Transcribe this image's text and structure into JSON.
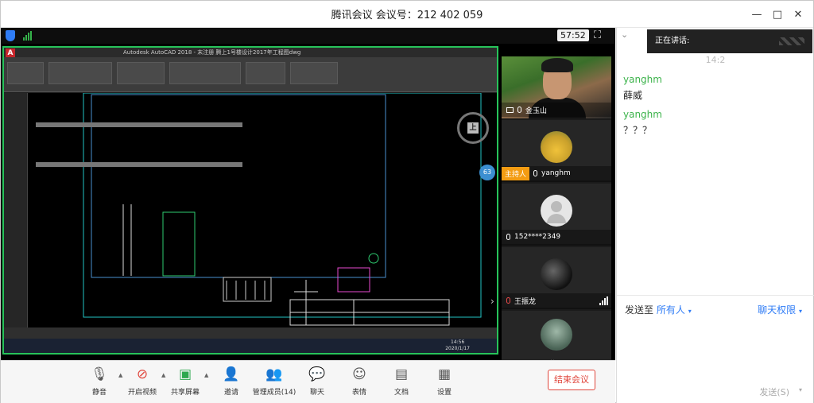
{
  "window": {
    "title": "腾讯会议 会议号：212 402 059",
    "minimize": "—",
    "maximize": "□",
    "close": "✕"
  },
  "video_bar": {
    "timer": "57:52"
  },
  "shared_screen": {
    "cad_title": "Autodesk AutoCAD 2018 - 末注册 腾上1号楼设计2017年工程图dwg",
    "cad_logo": "A",
    "zoom_pct": "63",
    "compass_label": "上",
    "clock_time": "14:56",
    "clock_date": "2020/1/17"
  },
  "participants": [
    {
      "name": "金玉山",
      "host": false,
      "has_share": true
    },
    {
      "name": "yanghm",
      "host": true,
      "host_label": "主持人"
    },
    {
      "name": "152****2349",
      "host": false
    },
    {
      "name": "王振龙",
      "host": false
    }
  ],
  "toolbar": {
    "mute": "静音",
    "video": "开启视频",
    "share": "共享屏幕",
    "invite": "邀请",
    "members": "管理成员(14)",
    "chat": "聊天",
    "emoji": "表情",
    "docs": "文档",
    "settings": "设置",
    "end": "结束会议"
  },
  "chat": {
    "speaking_label": "正在讲话:",
    "timestamp": "14:2",
    "messages": [
      {
        "sender": "yanghm",
        "text": "薛威"
      },
      {
        "sender": "yanghm",
        "text": "？？？"
      }
    ],
    "send_to_label": "发送至",
    "send_to_target": "所有人",
    "permission": "聊天权限",
    "send_button": "发送(S)"
  },
  "colors": {
    "accent": "#2f7cf6",
    "chat_sender": "#3cb34b",
    "end_button": "#e0463c",
    "share_border": "#27c35a",
    "host_tag": "#f39c12"
  }
}
